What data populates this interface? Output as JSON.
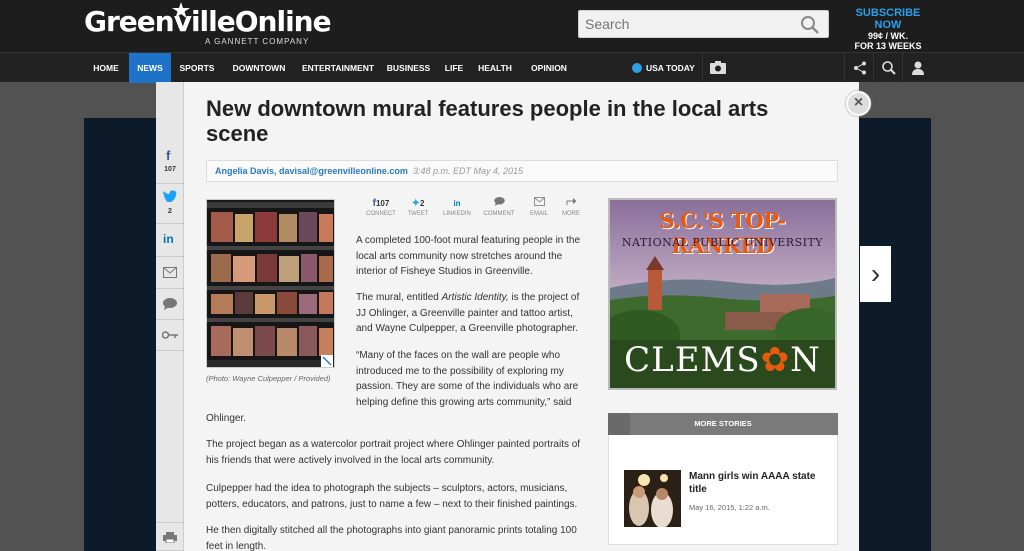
{
  "header": {
    "logo": "GreenvilleOnline",
    "logo_sub": "A GANNETT COMPANY",
    "search_placeholder": "Search",
    "subscribe_line1": "SUBSCRIBE NOW",
    "subscribe_line2": "99¢ / WK.",
    "subscribe_line3": "FOR 13 WEEKS"
  },
  "nav": {
    "items": [
      "HOME",
      "NEWS",
      "SPORTS",
      "DOWNTOWN",
      "ENTERTAINMENT",
      "BUSINESS",
      "LIFE",
      "HEALTH",
      "OPINION"
    ],
    "active": "NEWS",
    "usatoday": "USA TODAY"
  },
  "sidebar": {
    "facebook_count": "107",
    "twitter_count": "2"
  },
  "article": {
    "headline": "New downtown mural features people in the local arts scene",
    "author": "Angelia Davis, davisal@greenvilleonline.com",
    "timestamp": "3:48 p.m. EDT May 4, 2015",
    "caption": "(Photo: Wayne Culpepper / Provided)",
    "share": [
      {
        "top": "107",
        "label": "CONNECT"
      },
      {
        "top": "2",
        "label": "TWEET"
      },
      {
        "top": "in",
        "label": "LINKEDIN"
      },
      {
        "top": "",
        "label": "COMMENT"
      },
      {
        "top": "",
        "label": "EMAIL"
      },
      {
        "top": "",
        "label": "MORE"
      }
    ],
    "p1_a": "A completed 100-foot mural featuring people in the",
    "p1_b": "local arts community now stretches around the",
    "p1_c": "interior of Fisheye Studios in Greenville.",
    "p2_a": "The mural, entitled ",
    "p2_italic": "Artistic Identity,",
    "p2_a2": " is the project of",
    "p2_b": "JJ Ohlinger, a Greenville painter and tattoo artist,",
    "p2_c": "and Wayne Culpepper, a Greenville photographer.",
    "p3_a": "“Many of the faces on the wall are people who",
    "p3_b": "introduced me to the possibility of exploring my",
    "p3_c": "passion. They are some of the individuals who are",
    "p3_d": "helping define this growing arts community,” said",
    "p3_e": "Ohlinger.",
    "p4_a": "The project began as a watercolor portrait project where Ohlinger painted portraits of",
    "p4_b": "his friends that were actively involved in the local arts community.",
    "p5_a": "Culpepper had the idea to photograph the subjects – sculptors, actors, musicians,",
    "p5_b": "potters, educators, and patrons, just to name a few – next to their finished paintings.",
    "p6_a": "He then digitally stitched all the photographs into giant panoramic prints totaling 100",
    "p6_b": "feet in length."
  },
  "ad": {
    "line1": "S.C.'S TOP-RANKED",
    "line2": "NATIONAL PUBLIC UNIVERSITY",
    "brand": "CLEMS",
    "brand_end": "N"
  },
  "more_stories": {
    "title": "MORE STORIES",
    "story_title": "Mann girls win AAAA state title",
    "story_date": "May 16, 2015, 1:22 a.m."
  }
}
